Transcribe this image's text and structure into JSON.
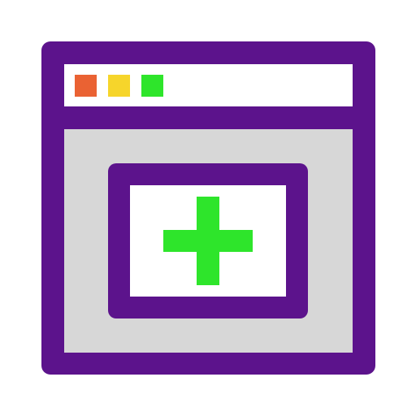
{
  "icon": {
    "name": "add-window-icon"
  },
  "colors": {
    "frame": "#5c138c",
    "titlebar_fill": "#ffffff",
    "content_fill": "#d7d7d7",
    "panel_fill": "#ffffff",
    "control_red": "#ea6233",
    "control_yellow": "#f6d52b",
    "control_green": "#2ee52b",
    "plus": "#2ee52b"
  },
  "window_controls": [
    {
      "name": "close-dot-icon",
      "color_key": "control_red"
    },
    {
      "name": "minimize-dot-icon",
      "color_key": "control_yellow"
    },
    {
      "name": "maximize-dot-icon",
      "color_key": "control_green"
    }
  ]
}
